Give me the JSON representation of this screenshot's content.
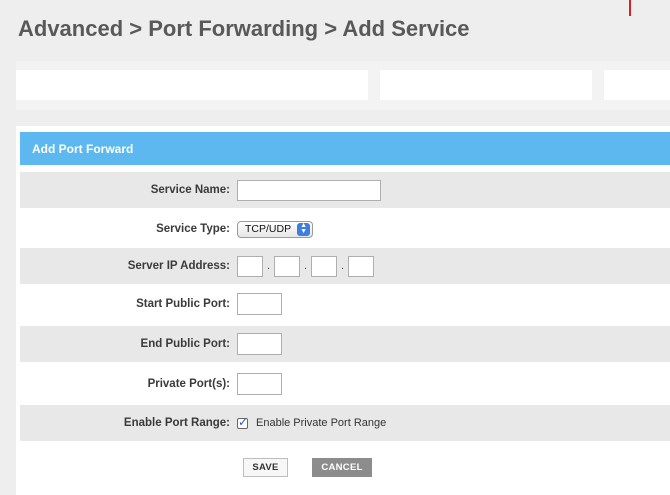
{
  "breadcrumb": {
    "title": "Advanced > Port Forwarding > Add Service"
  },
  "panel": {
    "header": "Add Port Forward",
    "rows": {
      "service_name": {
        "label": "Service Name:",
        "value": ""
      },
      "service_type": {
        "label": "Service Type:",
        "selected": "TCP/UDP"
      },
      "server_ip": {
        "label": "Server IP Address:",
        "octets": [
          "",
          "",
          "",
          ""
        ],
        "separator": "."
      },
      "start_public_port": {
        "label": "Start Public Port:",
        "value": ""
      },
      "end_public_port": {
        "label": "End Public Port:",
        "value": ""
      },
      "private_ports": {
        "label": "Private Port(s):",
        "value": ""
      },
      "enable_port_range": {
        "label": "Enable Port Range:",
        "checkbox_label": "Enable Private Port Range",
        "checked": true
      }
    }
  },
  "buttons": {
    "save": "SAVE",
    "cancel": "CANCEL"
  },
  "icons": {
    "select_arrow": "up-down-arrows-icon",
    "checkbox_mark": "checkmark-icon"
  },
  "colors": {
    "header_bg": "#5cb8ef",
    "accent_red": "#d2222a",
    "cancel_bg": "#8c8c8c"
  }
}
